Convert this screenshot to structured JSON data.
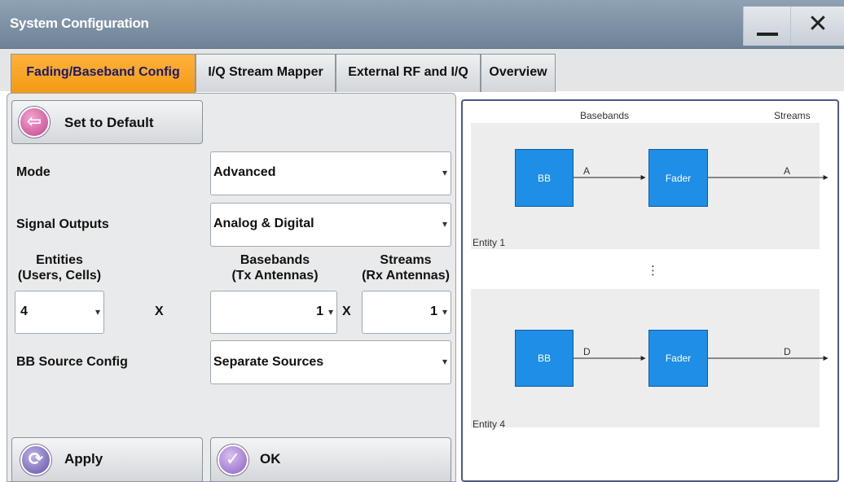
{
  "window": {
    "title": "System Configuration",
    "minimize_icon": "minimize-icon",
    "close_label": "✕"
  },
  "tabs": [
    {
      "label": "Fading/Baseband Config",
      "active": true
    },
    {
      "label": "I/Q Stream Mapper",
      "active": false
    },
    {
      "label": "External RF and I/Q",
      "active": false
    },
    {
      "label": "Overview",
      "active": false
    }
  ],
  "buttons": {
    "set_default": "Set to Default",
    "apply": "Apply",
    "ok": "OK"
  },
  "form": {
    "mode_label": "Mode",
    "mode_value": "Advanced",
    "signal_outputs_label": "Signal Outputs",
    "signal_outputs_value": "Analog & Digital",
    "entities_label_1": "Entities",
    "entities_label_2": "(Users, Cells)",
    "entities_value": "4",
    "basebands_label_1": "Basebands",
    "basebands_label_2": "(Tx Antennas)",
    "basebands_value": "1",
    "streams_label_1": "Streams",
    "streams_label_2": "(Rx Antennas)",
    "streams_value": "1",
    "multiply_sign": "X",
    "bb_source_label": "BB Source Config",
    "bb_source_value": "Separate Sources"
  },
  "diagram": {
    "header_basebands": "Basebands",
    "header_streams": "Streams",
    "ellipsis": "⋮",
    "entities": [
      {
        "name": "Entity 1",
        "bb_label": "BB",
        "fader_label": "Fader",
        "in_stream": "A",
        "out_stream": "A"
      },
      {
        "name": "Entity 4",
        "bb_label": "BB",
        "fader_label": "Fader",
        "in_stream": "D",
        "out_stream": "D"
      }
    ]
  },
  "colors": {
    "active_tab": "#f5a01c",
    "block_fill": "#1e8ee6",
    "title_bar": "#7f92a5"
  }
}
